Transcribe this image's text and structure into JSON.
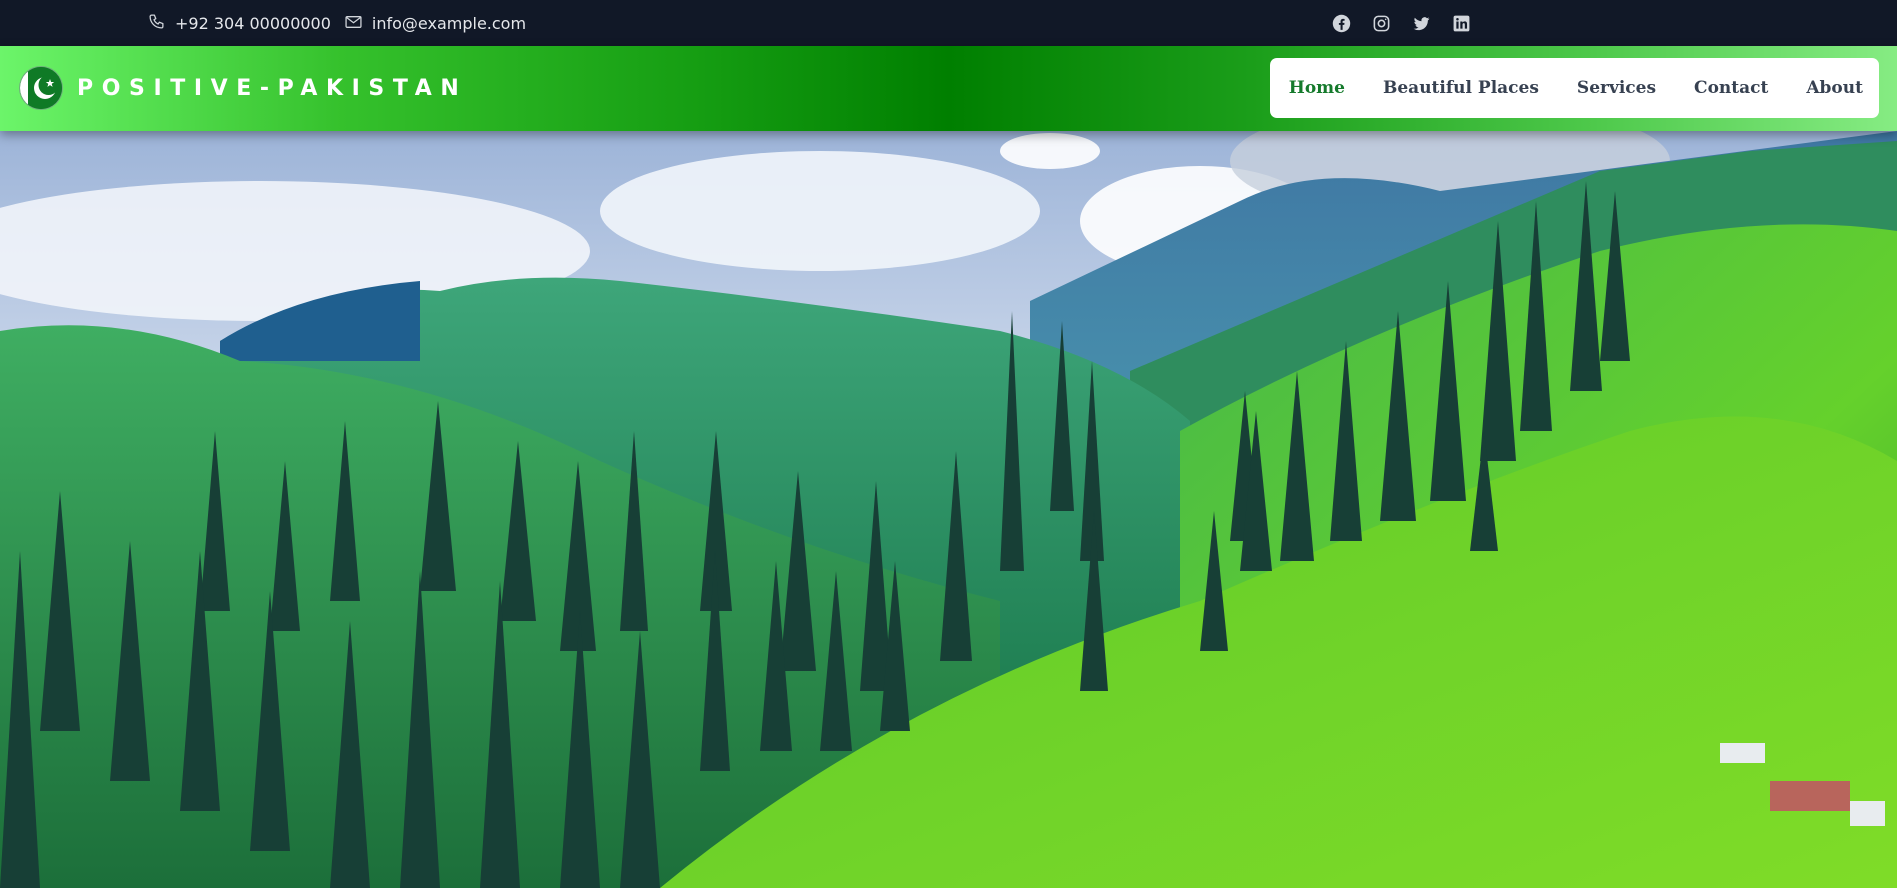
{
  "topbar": {
    "phone": "+92 304 00000000",
    "email": "info@example.com",
    "phone_icon": "phone-icon",
    "email_icon": "envelope-icon",
    "social": [
      {
        "name": "facebook",
        "icon": "facebook-icon"
      },
      {
        "name": "instagram",
        "icon": "instagram-icon"
      },
      {
        "name": "twitter",
        "icon": "twitter-icon"
      },
      {
        "name": "linkedin",
        "icon": "linkedin-icon"
      }
    ],
    "background": "#111827",
    "text_color": "#e5e7eb"
  },
  "navbar": {
    "brand": "POSITIVE-PAKISTAN",
    "logo_icon": "pakistan-flag-crescent-icon",
    "active_color": "#157a2c",
    "menu": [
      {
        "label": "Home",
        "active": true
      },
      {
        "label": "Beautiful Places",
        "active": false
      },
      {
        "label": "Services",
        "active": false
      },
      {
        "label": "Contact",
        "active": false
      },
      {
        "label": "About",
        "active": false
      }
    ]
  },
  "hero": {
    "image": "green-mountain-valley-with-pine-trees"
  }
}
